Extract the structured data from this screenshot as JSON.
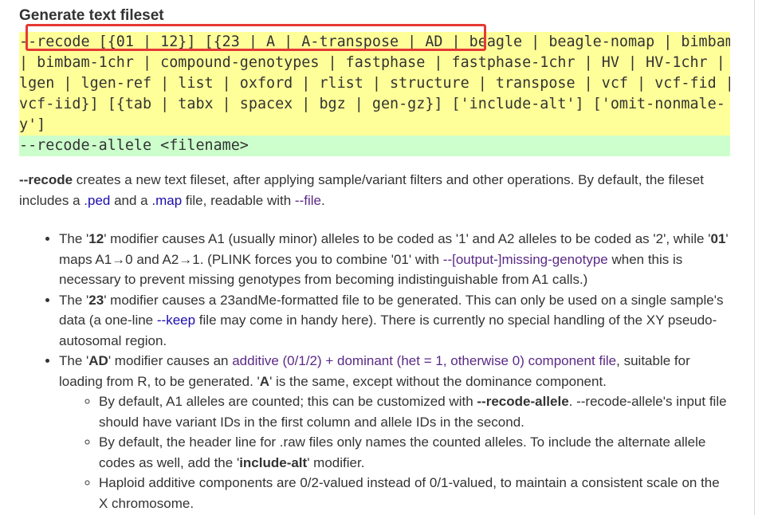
{
  "heading": "Generate text fileset",
  "syntax": {
    "lines": [
      "--recode [{01 | 12}] [{23 | A | A-transpose | AD | beagle | beagle-nomap | bimbam",
      "| bimbam-1chr | compound-genotypes | fastphase | fastphase-1chr | HV | HV-1chr |",
      "lgen | lgen-ref | list | oxford | rlist | structure | transpose | vcf | vcf-fid |",
      "vcf-iid}] [{tab | tabx | spacex | bgz | gen-gz}] ['include-alt'] ['omit-nonmale-",
      "y']"
    ],
    "second": "--recode-allele <filename>",
    "colors": {
      "yellow": "#ffff99",
      "green": "#ccffcc",
      "highlight": "#e53935"
    }
  },
  "desc": {
    "flag": "--recode",
    "text1": " creates a new text fileset, after applying sample/variant filters and other operations. By default, the fileset includes a ",
    "ped": ".ped",
    "text2": " and a ",
    "map": ".map",
    "text3": " file, readable with ",
    "file": "--file",
    "text4": "."
  },
  "bullets": {
    "b1": {
      "a": "The '",
      "m12": "12",
      "b": "' modifier causes A1 (usually minor) alleles to be coded as '1' and A2 alleles to be coded as '2', while '",
      "m01": "01",
      "c": "' maps A1→0 and A2→1. (PLINK forces you to combine '01' with ",
      "link": "--[output-]missing-genotype",
      "d": " when this is necessary to prevent missing genotypes from becoming indistinguishable from A1 calls.)"
    },
    "b2": {
      "a": "The '",
      "m23": "23",
      "b": "' modifier causes a 23andMe-formatted file to be generated. This can only be used on a single sample's data (a one-line ",
      "link": "--keep",
      "c": " file may come in handy here). There is currently no special handling of the XY pseudo-autosomal region."
    },
    "b3": {
      "a": "The '",
      "mAD": "AD",
      "b": "' modifier causes an ",
      "link": "additive (0/1/2) + dominant (het = 1, otherwise 0) component file",
      "c": ", suitable for loading from R, to be generated. '",
      "mA": "A",
      "d": "' is the same, except without the dominance component.",
      "sub": {
        "s1a": "By default, A1 alleles are counted; this can be customized with ",
        "s1b": "--recode-allele",
        "s1c": ". --recode-allele's input file should have variant IDs in the first column and allele IDs in the second.",
        "s2a": "By default, the header line for .raw files only names the counted alleles. To include the alternate allele codes as well, add the '",
        "s2b": "include-alt",
        "s2c": "' modifier.",
        "s3": "Haploid additive components are 0/2-valued instead of 0/1-valued, to maintain a consistent scale on the X chromosome."
      }
    }
  }
}
